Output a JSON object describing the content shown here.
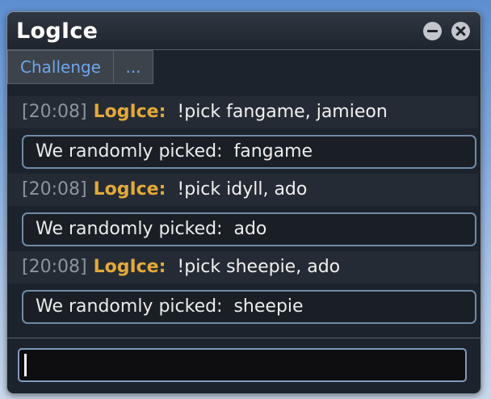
{
  "window": {
    "title": "LogIce"
  },
  "tabs": [
    {
      "label": "Challenge"
    },
    {
      "label": "..."
    }
  ],
  "messages": [
    {
      "timestamp": "[20:08]",
      "user": "LogIce:",
      "text": "!pick fangame, jamieon",
      "result": "We randomly picked:  fangame"
    },
    {
      "timestamp": "[20:08]",
      "user": "LogIce:",
      "text": "!pick idyll, ado",
      "result": "We randomly picked:  ado"
    },
    {
      "timestamp": "[20:08]",
      "user": "LogIce:",
      "text": "!pick sheepie, ado",
      "result": "We randomly picked:  sheepie"
    }
  ],
  "input": {
    "value": ""
  },
  "icons": {
    "minimize": "minimize-icon",
    "close": "close-icon"
  },
  "colors": {
    "username": "#e3a93a",
    "tab_text": "#6ea6ec",
    "timestamp": "#8e949c"
  }
}
